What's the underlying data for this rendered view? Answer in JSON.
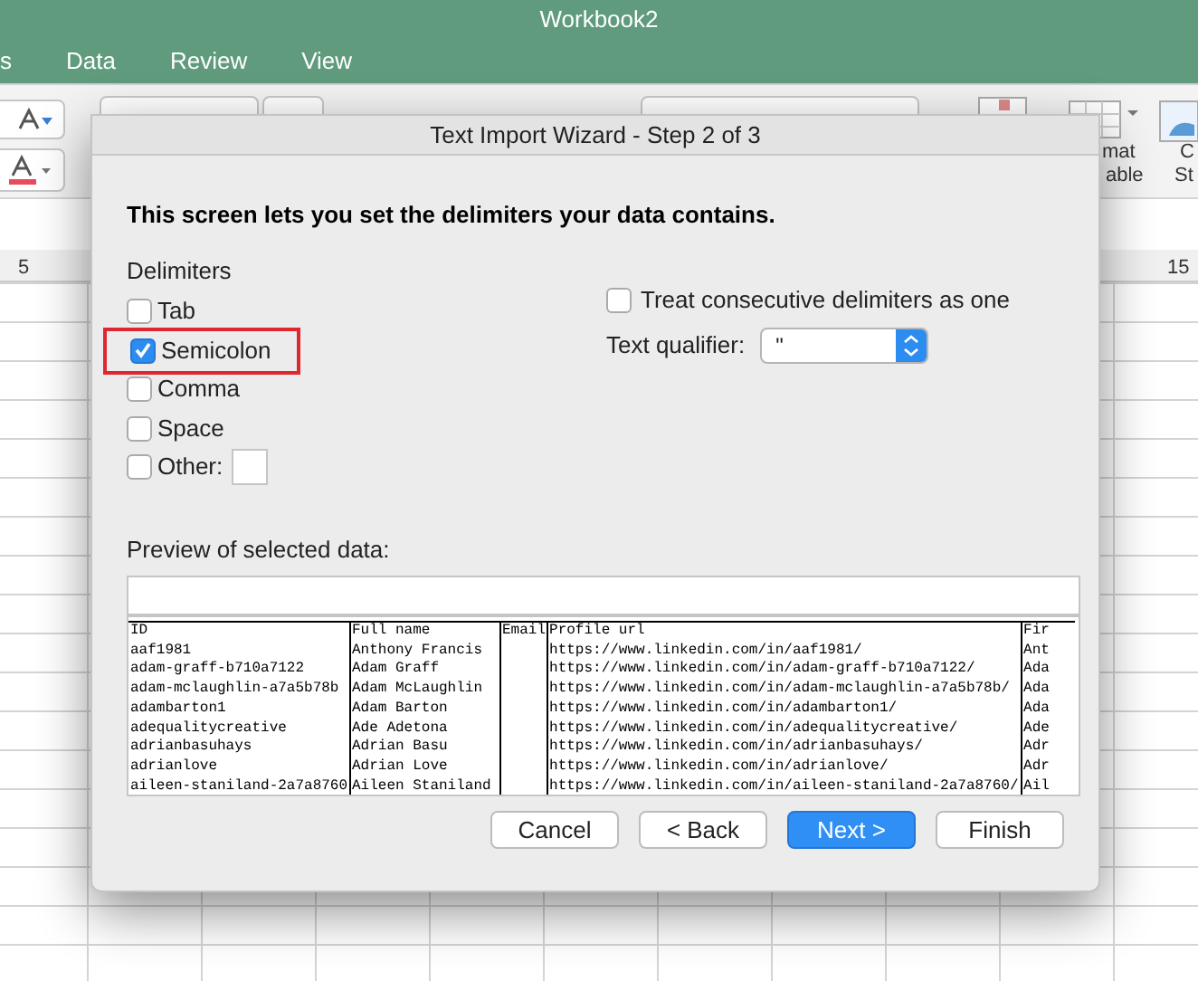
{
  "app": {
    "title": "Workbook2",
    "menu_tabs": [
      "s",
      "Data",
      "Review",
      "View"
    ],
    "ribbon_texts": [
      "mat",
      "able",
      "C",
      "St"
    ],
    "column_headers": [
      "5",
      "15"
    ]
  },
  "dialog": {
    "title": "Text Import Wizard - Step 2 of 3",
    "intro": "This screen lets you set the delimiters your data contains.",
    "delimiters_label": "Delimiters",
    "delimiters": [
      {
        "label": "Tab",
        "checked": false,
        "highlighted": false
      },
      {
        "label": "Semicolon",
        "checked": true,
        "highlighted": true
      },
      {
        "label": "Comma",
        "checked": false,
        "highlighted": false
      },
      {
        "label": "Space",
        "checked": false,
        "highlighted": false
      },
      {
        "label": "Other:",
        "checked": false,
        "highlighted": false,
        "kind": "other"
      }
    ],
    "consecutive": {
      "label": "Treat consecutive delimiters as one",
      "checked": false
    },
    "text_qualifier": {
      "label": "Text qualifier:",
      "value": "\""
    },
    "preview_label": "Preview of selected data:",
    "preview_columns": [
      "ID",
      "Full name",
      "Email",
      "Profile url",
      "Fir"
    ],
    "preview_rows": [
      [
        "aaf1981",
        "Anthony Francis",
        "",
        "https://www.linkedin.com/in/aaf1981/",
        "Ant"
      ],
      [
        "adam-graff-b710a7122",
        "Adam Graff",
        "",
        "https://www.linkedin.com/in/adam-graff-b710a7122/",
        "Ada"
      ],
      [
        "adam-mclaughlin-a7a5b78b",
        "Adam McLaughlin",
        "",
        "https://www.linkedin.com/in/adam-mclaughlin-a7a5b78b/",
        "Ada"
      ],
      [
        "adambarton1",
        "Adam Barton",
        "",
        "https://www.linkedin.com/in/adambarton1/",
        "Ada"
      ],
      [
        "adequalitycreative",
        "Ade Adetona",
        "",
        "https://www.linkedin.com/in/adequalitycreative/",
        "Ade"
      ],
      [
        "adrianbasuhays",
        "Adrian Basu",
        "",
        "https://www.linkedin.com/in/adrianbasuhays/",
        "Adr"
      ],
      [
        "adrianlove",
        "Adrian Love",
        "",
        "https://www.linkedin.com/in/adrianlove/",
        "Adr"
      ],
      [
        "aileen-staniland-2a7a8760",
        "Aileen Staniland",
        "",
        "https://www.linkedin.com/in/aileen-staniland-2a7a8760/",
        "Ail"
      ]
    ],
    "buttons": [
      {
        "label": "Cancel",
        "kind": "normal"
      },
      {
        "label": "< Back",
        "kind": "normal"
      },
      {
        "label": "Next >",
        "kind": "default"
      },
      {
        "label": "Finish",
        "kind": "normal"
      }
    ]
  }
}
